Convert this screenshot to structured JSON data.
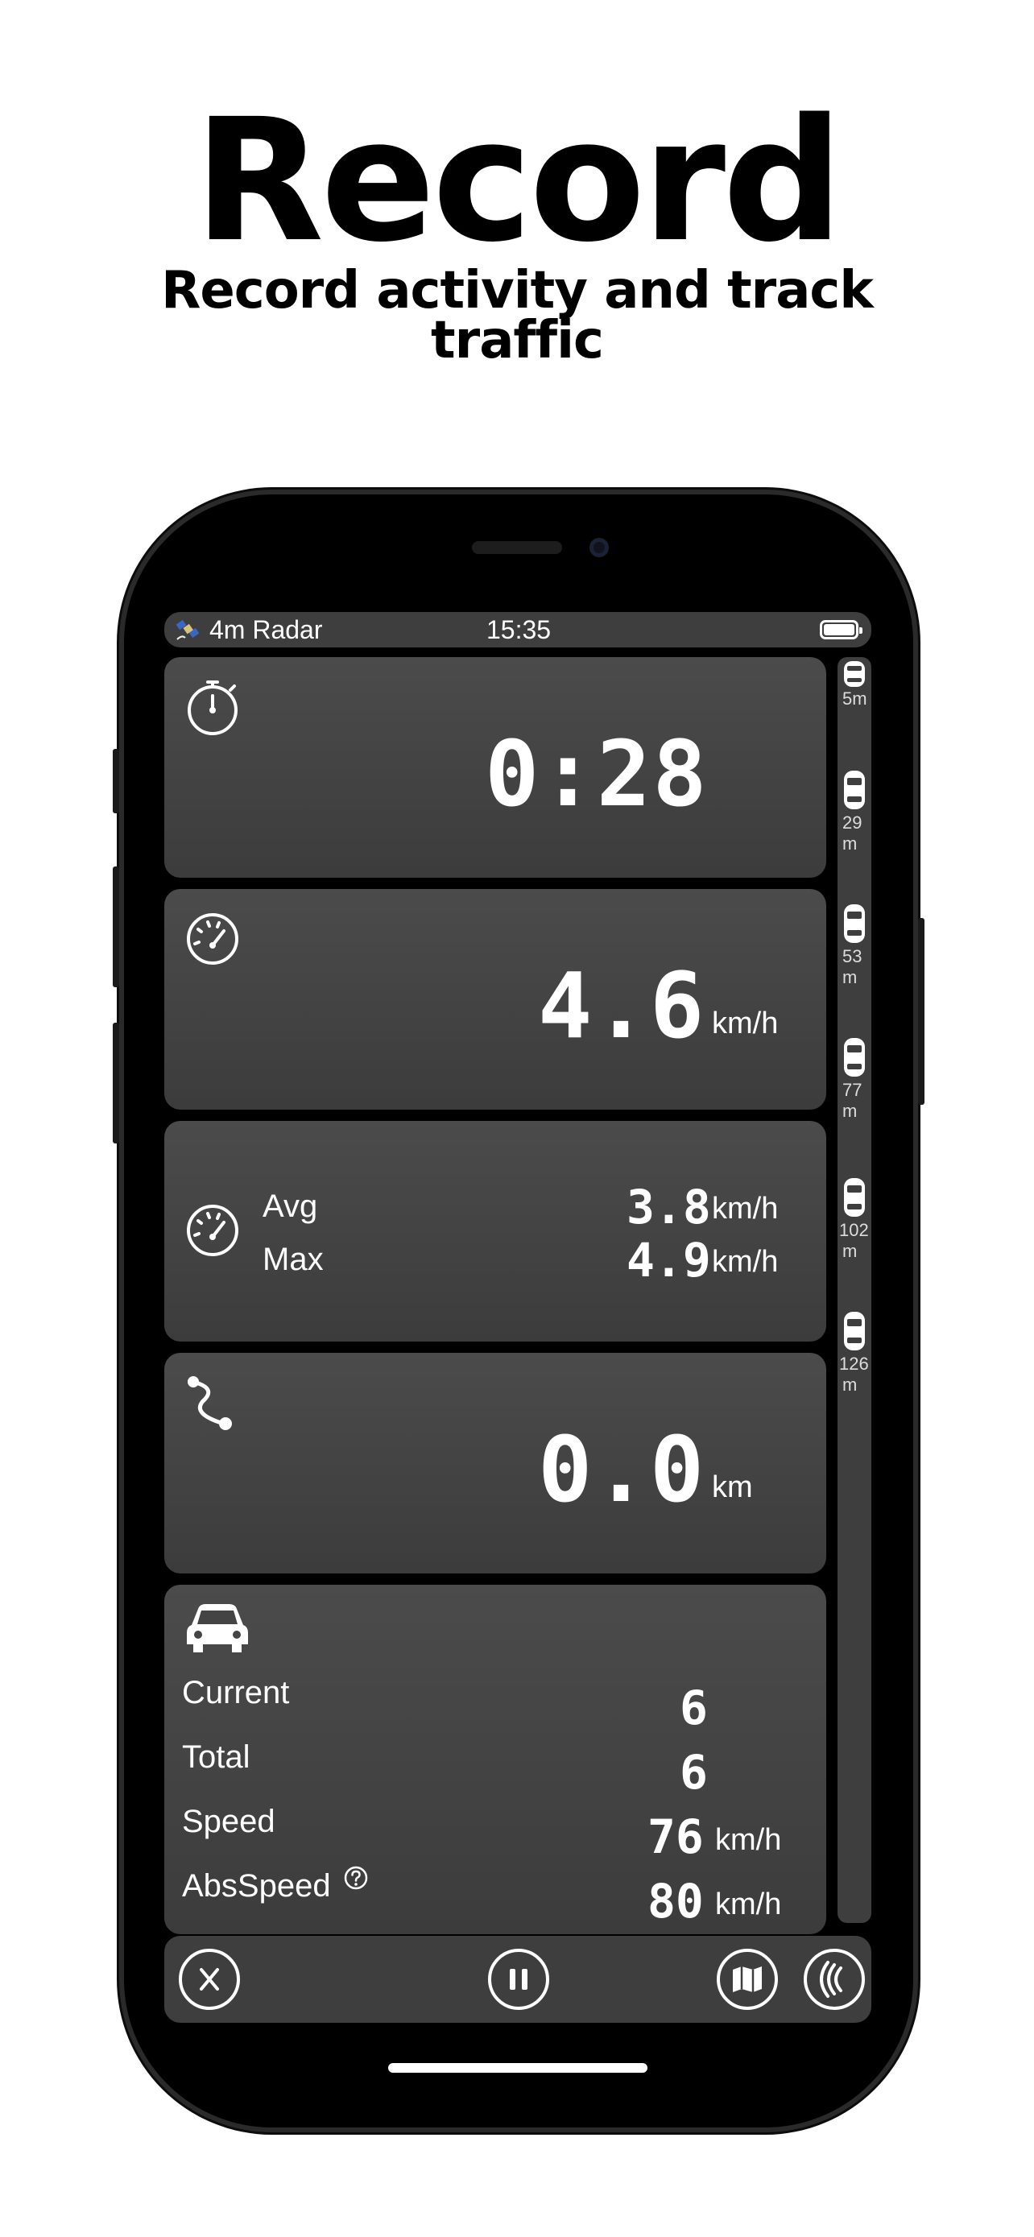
{
  "promo": {
    "title": "Record",
    "subtitle": "Record activity and track traffic"
  },
  "status_bar": {
    "app_label": "4m Radar",
    "time": "15:35",
    "battery_level": 1.0
  },
  "tiles": {
    "duration": {
      "icon": "stopwatch-icon",
      "value": "0:28"
    },
    "speed": {
      "icon": "speedometer-icon",
      "value": "4.6",
      "unit": "km/h"
    },
    "avg_max": {
      "icon": "speedometer-icon",
      "avg_label": "Avg",
      "avg_value": "3.8",
      "avg_unit": "km/h",
      "max_label": "Max",
      "max_value": "4.9",
      "max_unit": "km/h"
    },
    "distance": {
      "icon": "route-icon",
      "value": "0.0",
      "unit": "km"
    },
    "traffic": {
      "icon": "car-icon",
      "rows": [
        {
          "label": "Current",
          "value": "6",
          "unit": ""
        },
        {
          "label": "Total",
          "value": "6",
          "unit": ""
        },
        {
          "label": "Speed",
          "value": "76",
          "unit": "km/h"
        },
        {
          "label": "AbsSpeed",
          "value": "80",
          "unit": "km/h"
        }
      ],
      "help_icon": "question-circle-icon"
    }
  },
  "radar": {
    "vehicles": [
      {
        "line1": "5m",
        "line2": ""
      },
      {
        "line1": "29",
        "line2": "m"
      },
      {
        "line1": "53",
        "line2": "m"
      },
      {
        "line1": "77",
        "line2": "m"
      },
      {
        "line1": "102",
        "line2": "m"
      },
      {
        "line1": "126",
        "line2": "m"
      }
    ]
  },
  "toolbar": {
    "buttons": [
      "close-icon",
      "pause-icon",
      "map-icon",
      "radar-signal-icon"
    ]
  }
}
